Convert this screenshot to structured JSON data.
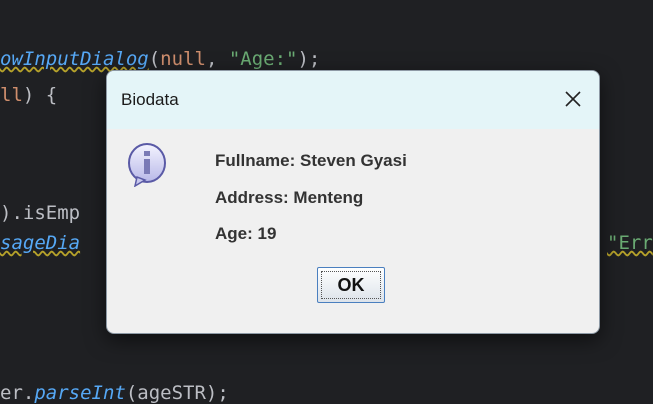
{
  "editor": {
    "line1": {
      "fn": "owInputDialog",
      "open": "(",
      "kw": "null",
      "sep": ", ",
      "str": "\"Age:\"",
      "close": ");"
    },
    "line2": {
      "kw": "ll",
      "rest": ") {"
    },
    "line3": {
      "text": ").isEmp"
    },
    "line4": {
      "fn": "sageDia",
      "str": "\"Err"
    },
    "line5": {
      "prefix": "er.",
      "fn": "parseInt",
      "rest": "(ageSTR);"
    }
  },
  "dialog": {
    "title": "Biodata",
    "icon": "info-icon",
    "lines": {
      "fullname": "Fullname: Steven Gyasi",
      "address": "Address: Menteng",
      "age": "Age: 19"
    },
    "ok_label": "OK"
  },
  "colors": {
    "editor_bg": "#1f2023",
    "titlebar_bg": "#e4f5f8",
    "dialog_bg": "#f0f0f0",
    "string": "#6aab73",
    "keyword": "#cf8e6d",
    "function": "#56a8f5"
  }
}
